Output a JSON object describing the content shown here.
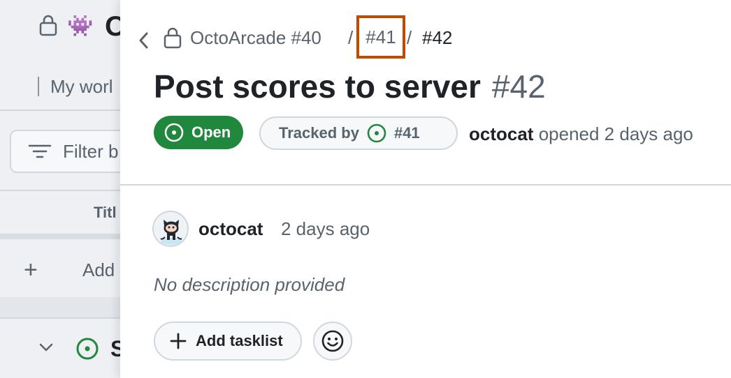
{
  "background": {
    "project_title": "O",
    "tab_label": "My worl",
    "filter_placeholder": "Filter b",
    "column_title": "Titl",
    "add_item_label": "Add",
    "group_label": "S",
    "project_emoji": "👾"
  },
  "breadcrumb": {
    "project": "OctoArcade #40",
    "separator": "/",
    "parent_issue": "#41",
    "current_issue": "#42"
  },
  "issue": {
    "title": "Post scores to server",
    "number": "#42",
    "state": "Open",
    "tracked_by_label": "Tracked by",
    "tracked_by_issue": "#41",
    "author": "octocat",
    "opened_text": "opened 2 days ago"
  },
  "comment": {
    "author": "octocat",
    "time": "2 days ago",
    "body": "No description provided"
  },
  "actions": {
    "add_tasklist": "Add tasklist"
  },
  "colors": {
    "open_green": "#1f883d",
    "highlight": "#bc4c00",
    "muted": "#59636e"
  }
}
